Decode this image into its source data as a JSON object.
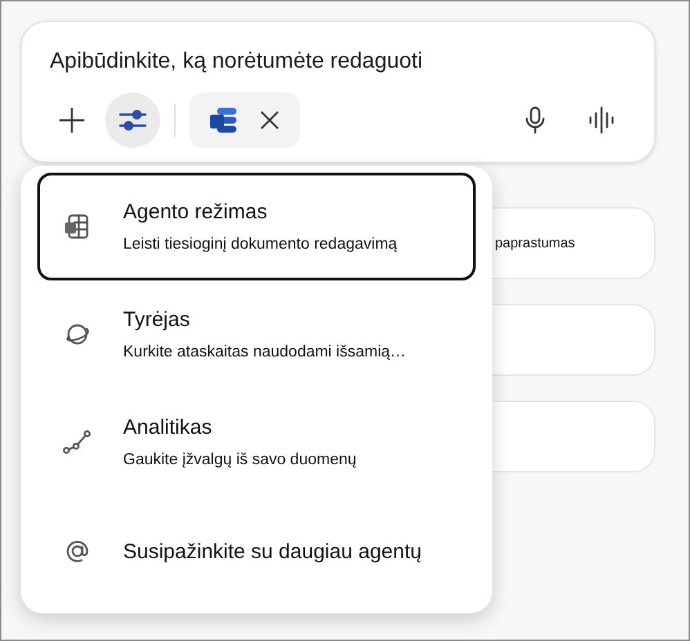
{
  "composer": {
    "placeholder": "Apibūdinkite, ką norėtumėte redaguoti",
    "tools_button": {
      "selected": true
    }
  },
  "background_card": {
    "text": "paprastumas"
  },
  "menu": {
    "items": [
      {
        "kind": "agent",
        "title": "Agento režimas",
        "subtitle": "Leisti tiesioginį dokumento redagavimą",
        "selected": true
      },
      {
        "kind": "agent",
        "title": "Tyrėjas",
        "subtitle": "Kurkite ataskaitas naudodami išsamią…",
        "selected": false
      },
      {
        "kind": "agent",
        "title": "Analitikas",
        "subtitle": "Gaukite įžvalgų iš savo duomenų",
        "selected": false
      },
      {
        "kind": "link",
        "title": "Susipažinkite su daugiau agentų",
        "selected": false
      }
    ]
  }
}
